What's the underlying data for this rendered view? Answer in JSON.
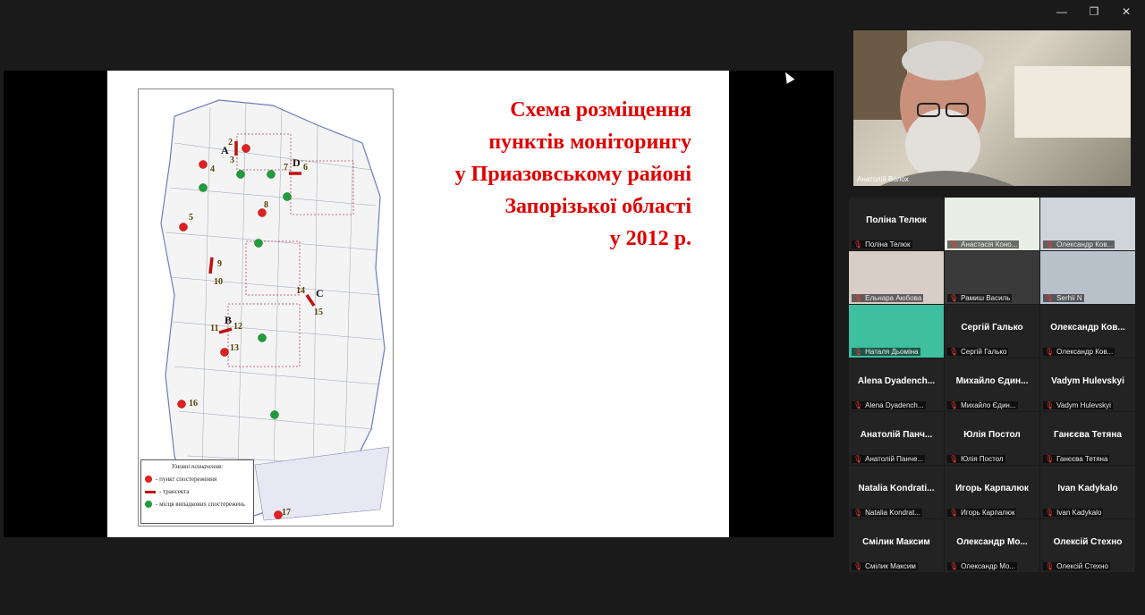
{
  "window": {
    "controls": [
      "—",
      "❐",
      "✕"
    ]
  },
  "slide": {
    "title_lines": [
      "Схема розміщення",
      "пунктів моніторингу",
      "у   Приазовському районі",
      "Запорізької області",
      "у 2012 р."
    ],
    "map_letters": [
      "A",
      "B",
      "C",
      "D"
    ],
    "map_numbers": [
      "2",
      "3",
      "4",
      "5",
      "6",
      "7",
      "8",
      "9",
      "10",
      "11",
      "12",
      "13",
      "14",
      "15",
      "16",
      "17"
    ],
    "legend": {
      "title": "Умовні позначення:",
      "items": [
        {
          "label": "- пункт спостереження",
          "color": "#e02020"
        },
        {
          "label": "- трансекта",
          "color": "#c01010"
        },
        {
          "label": "- місця випадкових спостережень",
          "color": "#1e9e3a"
        }
      ]
    }
  },
  "speaker": {
    "name": "Анатолій Волох"
  },
  "gallery": [
    {
      "big": "Поліна Телюк",
      "label": "Поліна Телюк",
      "video": false
    },
    {
      "big": "",
      "label": "Анастасія Коно...",
      "video": true,
      "color": "#e9efe6"
    },
    {
      "big": "",
      "label": "Олександр Ков...",
      "video": true,
      "color": "#cfd5db"
    },
    {
      "big": "",
      "label": "Ельнара Аюбова",
      "video": true,
      "color": "#d8cdc7"
    },
    {
      "big": "",
      "label": "Рамиш Василь",
      "video": true,
      "color": "#3a3a3a"
    },
    {
      "big": "",
      "label": "Serhii N",
      "video": true,
      "color": "#b9c2ca"
    },
    {
      "big": "",
      "label": "Наталя Дьоміна",
      "video": true,
      "color": "#3dbfa0"
    },
    {
      "big": "Сергій Галько",
      "label": "Сергій Галько",
      "video": false
    },
    {
      "big": "Олександр  Ков...",
      "label": "Олександр Ков...",
      "video": false
    },
    {
      "big": "Alena  Dyadench...",
      "label": "Alena Dyadench...",
      "video": false
    },
    {
      "big": "Михайло  Єдин...",
      "label": "Михайло Єдин...",
      "video": false
    },
    {
      "big": "Vadym  Hulevskyi",
      "label": "Vadym Hulevskyi",
      "video": false
    },
    {
      "big": "Анатолій  Панч...",
      "label": "Анатолій Панче...",
      "video": false
    },
    {
      "big": "Юлія  Постол",
      "label": "Юлія Постол",
      "video": false
    },
    {
      "big": "Ганєєва  Тетяна",
      "label": "Ганєєва Тетяна",
      "video": false
    },
    {
      "big": "Natalia  Kondrati...",
      "label": "Natalia Kondrat...",
      "video": false
    },
    {
      "big": "Игорь  Карпалюк",
      "label": "Игорь Карпалюк",
      "video": false
    },
    {
      "big": "Ivan  Kadykalo",
      "label": "Ivan Kadykalo",
      "video": false
    },
    {
      "big": "Смілик  Максим",
      "label": "Смілик Максим",
      "video": false
    },
    {
      "big": "Олександр  Мо...",
      "label": "Олександр Мо...",
      "video": false
    },
    {
      "big": "Олексій  Стехно",
      "label": "Олексій Стехно",
      "video": false
    }
  ]
}
